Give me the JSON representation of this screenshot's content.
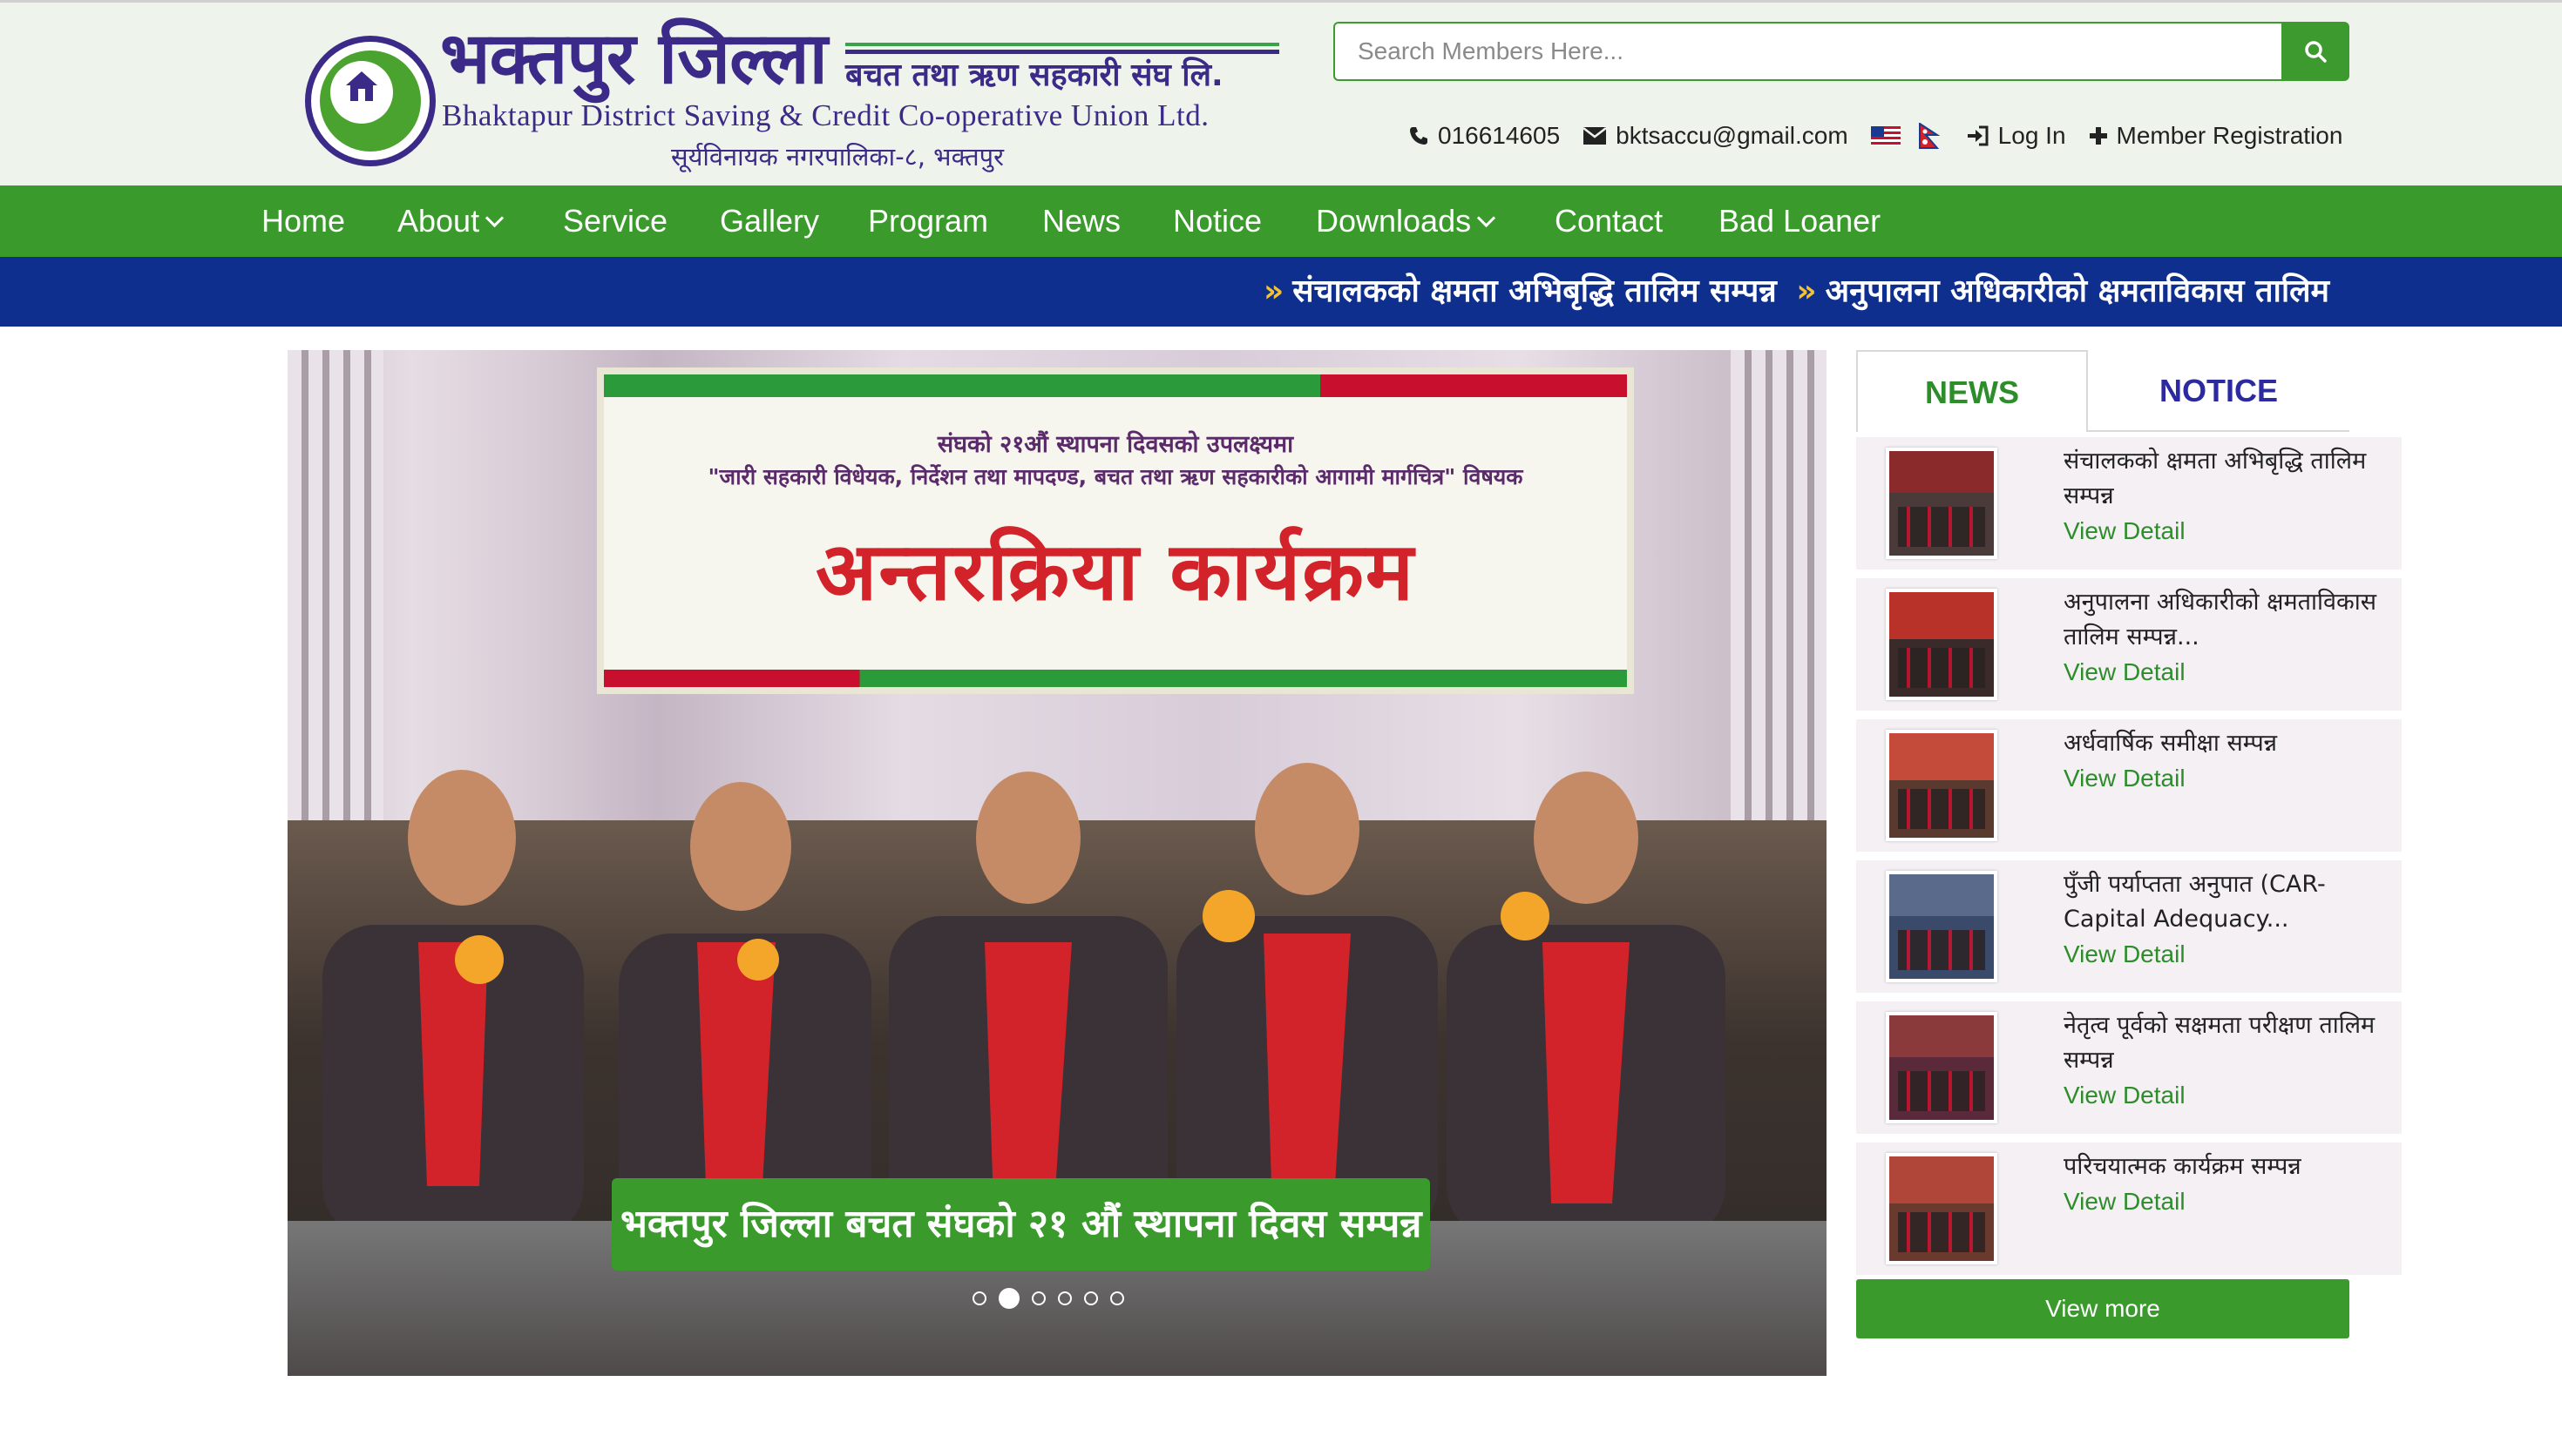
{
  "header": {
    "brand_np": "भक्तपुर जिल्ला",
    "brand_np_sub": "बचत तथा ऋण सहकारी संघ लि.",
    "brand_en": "Bhaktapur District Saving & Credit Co-operative Union Ltd.",
    "address": "सूर्यविनायक नगरपालिका-८, भक्तपुर",
    "search_placeholder": "Search Members Here...",
    "phone": "016614605",
    "email": "bktsaccu@gmail.com",
    "login_label": "Log In",
    "register_label": "Member Registration"
  },
  "nav": {
    "items": [
      "Home",
      "About",
      "Service",
      "Gallery",
      "Program",
      "News",
      "Notice",
      "Downloads",
      "Contact",
      "Bad Loaner"
    ]
  },
  "ticker": {
    "items": [
      "संचालकको क्षमता अभिबृद्धि तालिम सम्पन्न",
      "अनुपालना अधिकारीको क्षमताविकास तालिम"
    ]
  },
  "slider": {
    "caption": "भक्तपुर जिल्ला बचत संघको २१ औं स्थापना दिवस सम्पन्न",
    "active_index": 1,
    "slide_count": 6
  },
  "tabs": {
    "news": "NEWS",
    "notice": "NOTICE"
  },
  "news": [
    {
      "title": "संचालकको क्षमता अभिबृद्धि तालिम सम्पन्न",
      "link": "View Detail"
    },
    {
      "title": "अनुपालना अधिकारीको क्षमताविकास तालिम सम्पन्न...",
      "link": "View Detail"
    },
    {
      "title": "अर्धवार्षिक समीक्षा सम्पन्न",
      "link": "View Detail"
    },
    {
      "title": "पुँजी पर्याप्तता अनुपात (CAR-Capital Adequacy...",
      "link": "View Detail"
    },
    {
      "title": "नेतृत्व पूर्वको सक्षमता परीक्षण तालिम सम्पन्न",
      "link": "View Detail"
    },
    {
      "title": "परिचयात्मक कार्यक्रम सम्पन्न",
      "link": "View Detail"
    }
  ],
  "view_more": "View more",
  "colors": {
    "brand_purple": "#3b2a87",
    "nav_green": "#3a9a2c",
    "ticker_blue": "#0f2f8f",
    "link_green": "#2c8d2a"
  }
}
